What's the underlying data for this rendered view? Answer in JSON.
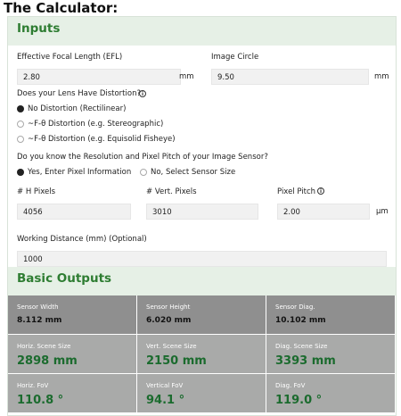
{
  "page": {
    "title": "The Calculator:"
  },
  "inputs": {
    "heading": "Inputs",
    "efl": {
      "label": "Effective Focal Length (EFL)",
      "value": "2.80",
      "unit": "mm"
    },
    "image_circle": {
      "label": "Image Circle",
      "value": "9.50",
      "unit": "mm"
    },
    "distortion": {
      "question": "Does your Lens Have Distortion?",
      "options": [
        {
          "label": "No Distortion (Rectilinear)",
          "selected": true
        },
        {
          "label": "~F-θ Distortion (e.g. Stereographic)",
          "selected": false
        },
        {
          "label": "~F-θ Distortion (e.g. Equisolid Fisheye)",
          "selected": false
        }
      ]
    },
    "resolution": {
      "question": "Do you know the Resolution and Pixel Pitch of your Image Sensor?",
      "options": [
        {
          "label": "Yes, Enter Pixel Information",
          "selected": true
        },
        {
          "label": "No, Select Sensor Size",
          "selected": false
        }
      ]
    },
    "h_pixels": {
      "label": "# H Pixels",
      "value": "4056"
    },
    "v_pixels": {
      "label": "# Vert. Pixels",
      "value": "3010"
    },
    "pixel_pitch": {
      "label": "Pixel Pitch",
      "value": "2.00",
      "unit": "µm"
    },
    "working_distance": {
      "label": "Working Distance (mm) (Optional)",
      "value": "1000"
    }
  },
  "outputs": {
    "heading": "Basic Outputs",
    "rows": [
      [
        {
          "title": "Sensor Width",
          "value": "8.112 mm"
        },
        {
          "title": "Sensor Height",
          "value": "6.020 mm"
        },
        {
          "title": "Sensor Diag.",
          "value": "10.102 mm"
        }
      ],
      [
        {
          "title": "Horiz. Scene Size",
          "value": "2898 mm"
        },
        {
          "title": "Vert. Scene Size",
          "value": "2150 mm"
        },
        {
          "title": "Diag. Scene Size",
          "value": "3393 mm"
        }
      ],
      [
        {
          "title": "Horiz. FoV",
          "value": "110.8 °"
        },
        {
          "title": "Vertical FoV",
          "value": "94.1 °"
        },
        {
          "title": "Diag. FoV",
          "value": "119.0 °"
        }
      ]
    ]
  },
  "colors": {
    "accent_green": "#2e7d32",
    "value_green": "#1b6b2e",
    "header_bg": "#e6f0e6",
    "cell_dark": "#8f8f8f",
    "cell_light": "#a9aaa9"
  }
}
